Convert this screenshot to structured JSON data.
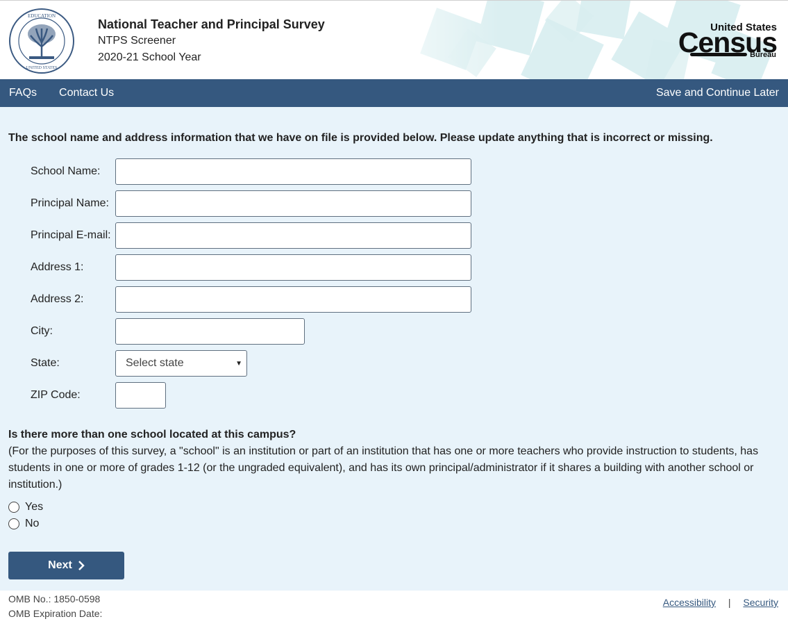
{
  "header": {
    "title": "National Teacher and Principal Survey",
    "subtitle": "NTPS Screener",
    "school_year": "2020-21 School Year",
    "seal_text": "DEPARTMENT OF EDUCATION · UNITED STATES OF AMERICA",
    "census_logo": {
      "top": "United States",
      "main": "Census",
      "bottom": "Bureau"
    }
  },
  "nav": {
    "faqs": "FAQs",
    "contact": "Contact Us",
    "save": "Save and Continue Later"
  },
  "form": {
    "intro": "The school name and address information that we have on file is provided below. Please update anything that is incorrect or missing.",
    "fields": {
      "school_name": {
        "label": "School Name:",
        "value": ""
      },
      "principal_name": {
        "label": "Principal Name:",
        "value": ""
      },
      "principal_email": {
        "label": "Principal E-mail:",
        "value": ""
      },
      "address1": {
        "label": "Address 1:",
        "value": ""
      },
      "address2": {
        "label": "Address 2:",
        "value": ""
      },
      "city": {
        "label": "City:",
        "value": ""
      },
      "state": {
        "label": "State:",
        "selected": "Select state"
      },
      "zip": {
        "label": "ZIP Code:",
        "value": ""
      }
    },
    "question": {
      "text": "Is there more than one school located at this campus?",
      "note": "(For the purposes of this survey, a \"school\" is an institution or part of an institution that has one or more teachers who provide instruction to students, has students in one or more of grades 1-12 (or the ungraded equivalent), and has its own principal/administrator if it shares a building with another school or institution.)",
      "options": [
        "Yes",
        "No"
      ]
    },
    "next": "Next"
  },
  "footer": {
    "omb_no": "OMB No.: 1850-0598",
    "omb_exp": "OMB Expiration Date:",
    "accessibility": "Accessibility",
    "separator": "|",
    "security": "Security"
  },
  "colors": {
    "nav": "#35587f",
    "main_bg": "#e8f3fa"
  }
}
